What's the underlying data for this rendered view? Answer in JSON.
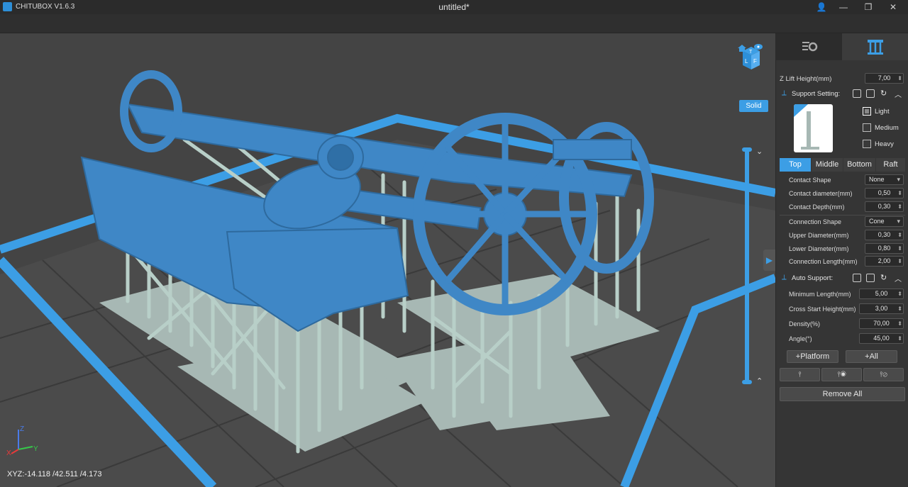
{
  "app": {
    "title": "CHITUBOX V1.6.3",
    "document": "untitled*"
  },
  "window_controls": {
    "user": "👤",
    "minimize": "—",
    "restore": "❐",
    "close": "✕"
  },
  "viewport": {
    "render_mode": "Solid",
    "xyz_readout": "XYZ:-14.118 /42.511 /4.173",
    "axes": {
      "z": "Z",
      "x": "X",
      "y": "Y"
    },
    "cube_labels": {
      "top": "T",
      "left": "L",
      "front": "F"
    },
    "slider_up": "⌄",
    "slider_down": "⌃",
    "colors": {
      "model": "#3f87c6",
      "support": "#b8cfc8",
      "plate": "#a7b8b4",
      "frame": "#3c9ee5",
      "bed": "#4b4b4b"
    }
  },
  "panel": {
    "z_lift": {
      "label": "Z Lift Height(mm)",
      "value": "7,00"
    },
    "support_setting": {
      "label": "Support Setting:"
    },
    "presets": [
      {
        "label": "Light",
        "checked": true
      },
      {
        "label": "Medium",
        "checked": false
      },
      {
        "label": "Heavy",
        "checked": false
      }
    ],
    "tabs": [
      {
        "label": "Top",
        "active": true
      },
      {
        "label": "Middle",
        "active": false
      },
      {
        "label": "Bottom",
        "active": false
      },
      {
        "label": "Raft",
        "active": false
      }
    ],
    "params": {
      "contact_shape": {
        "label": "Contact Shape",
        "value": "None"
      },
      "contact_diameter": {
        "label": "Contact diameter(mm)",
        "value": "0,50"
      },
      "contact_depth": {
        "label": "Contact Depth(mm)",
        "value": "0,30"
      },
      "connection_shape": {
        "label": "Connection Shape",
        "value": "Cone"
      },
      "upper_diameter": {
        "label": "Upper Diameter(mm)",
        "value": "0,30"
      },
      "lower_diameter": {
        "label": "Lower Diameter(mm)",
        "value": "0,80"
      },
      "connection_length": {
        "label": "Connection Length(mm)",
        "value": "2,00"
      }
    },
    "auto_support": {
      "label": "Auto Support:",
      "min_length": {
        "label": "Minimum Length(mm)",
        "value": "5,00"
      },
      "cross_start": {
        "label": "Cross Start Height(mm)",
        "value": "3,00"
      },
      "density": {
        "label": "Density(%)",
        "value": "70,00"
      },
      "angle": {
        "label": "Angle(°)",
        "value": "45,00"
      }
    },
    "buttons": {
      "platform": "+Platform",
      "all": "+All",
      "remove_all": "Remove All"
    }
  }
}
